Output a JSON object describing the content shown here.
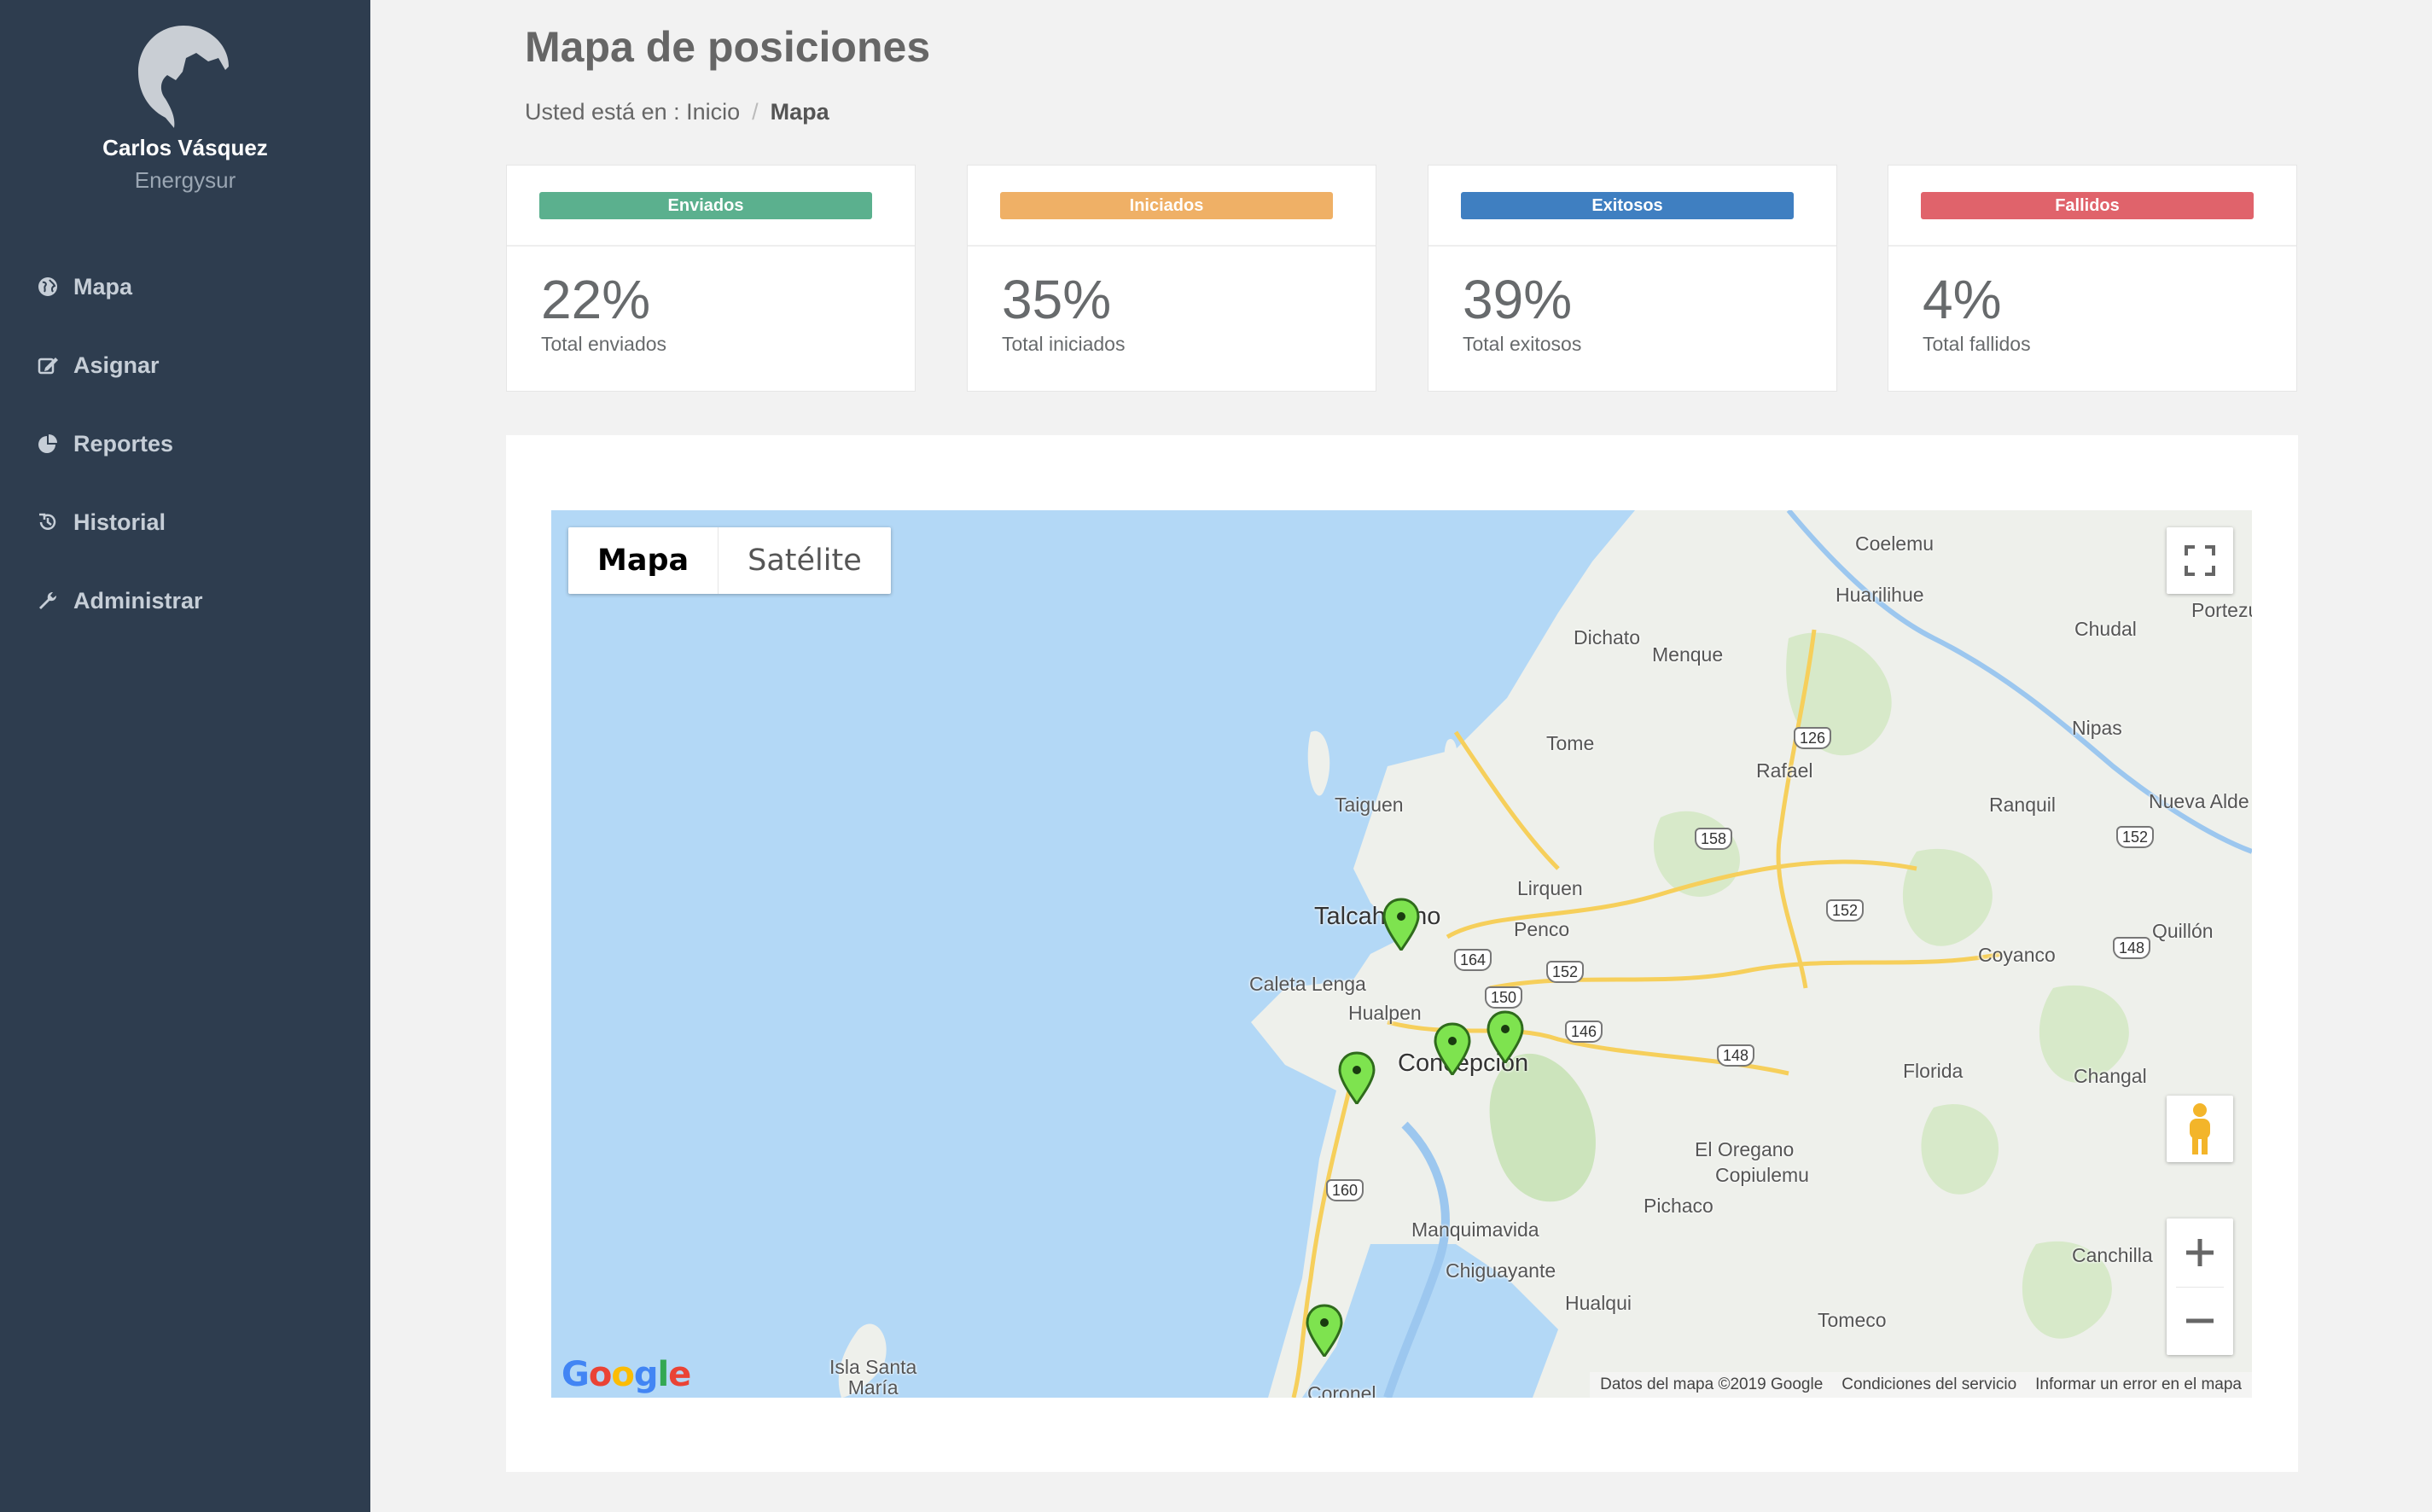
{
  "sidebar": {
    "user_name": "Carlos Vásquez",
    "company": "Energysur",
    "items": [
      {
        "label": "Mapa",
        "icon": "globe-icon"
      },
      {
        "label": "Asignar",
        "icon": "edit-icon"
      },
      {
        "label": "Reportes",
        "icon": "pie-chart-icon"
      },
      {
        "label": "Historial",
        "icon": "history-icon"
      },
      {
        "label": "Administrar",
        "icon": "wrench-icon"
      }
    ]
  },
  "header": {
    "title": "Mapa de posiciones",
    "breadcrumb_prefix": "Usted está en : Inicio",
    "breadcrumb_sep": "/",
    "breadcrumb_current": "Mapa"
  },
  "stats": [
    {
      "badge": "Enviados",
      "value": "22%",
      "label": "Total enviados",
      "color": "#5bb08e"
    },
    {
      "badge": "Iniciados",
      "value": "35%",
      "label": "Total iniciados",
      "color": "#efb066"
    },
    {
      "badge": "Exitosos",
      "value": "39%",
      "label": "Total exitosos",
      "color": "#3f7fc1"
    },
    {
      "badge": "Fallidos",
      "value": "4%",
      "label": "Total fallidos",
      "color": "#e0636b"
    }
  ],
  "map": {
    "type_map": "Mapa",
    "type_satellite": "Satélite",
    "places": {
      "coelemu": "Coelemu",
      "huarilihue": "Huarilihue",
      "portezuelo": "Portezu",
      "chudal": "Chudal",
      "dichato": "Dichato",
      "menque": "Menque",
      "tome": "Tome",
      "rafael": "Rafael",
      "nipas": "Nipas",
      "taiguen": "Taiguen",
      "ranquil": "Ranquil",
      "nueva_aldea": "Nueva Alde",
      "lirquen": "Lirquen",
      "talcahuano": "Talcahuano",
      "penco": "Penco",
      "coyanco": "Coyanco",
      "quillon": "Quillón",
      "caleta_lenga": "Caleta Lenga",
      "hualpen": "Hualpen",
      "concepcion": "Concepción",
      "florida": "Florida",
      "changal": "Changal",
      "el_oregano": "El Oregano",
      "copiulemu": "Copiulemu",
      "pichaco": "Pichaco",
      "manquimavida": "Manquimavida",
      "chiguayante": "Chiguayante",
      "canchilla": "Canchilla",
      "hualqui": "Hualqui",
      "tomeco": "Tomeco",
      "isla_santa_maria": "Isla Santa\nMaría",
      "coronel": "Coronel"
    },
    "shields": [
      "126",
      "158",
      "152",
      "152",
      "164",
      "152",
      "150",
      "146",
      "148",
      "148",
      "160"
    ],
    "attribution": {
      "data": "Datos del mapa ©2019 Google",
      "terms": "Condiciones del servicio",
      "report": "Informar un error en el mapa"
    },
    "logo": "Google"
  }
}
